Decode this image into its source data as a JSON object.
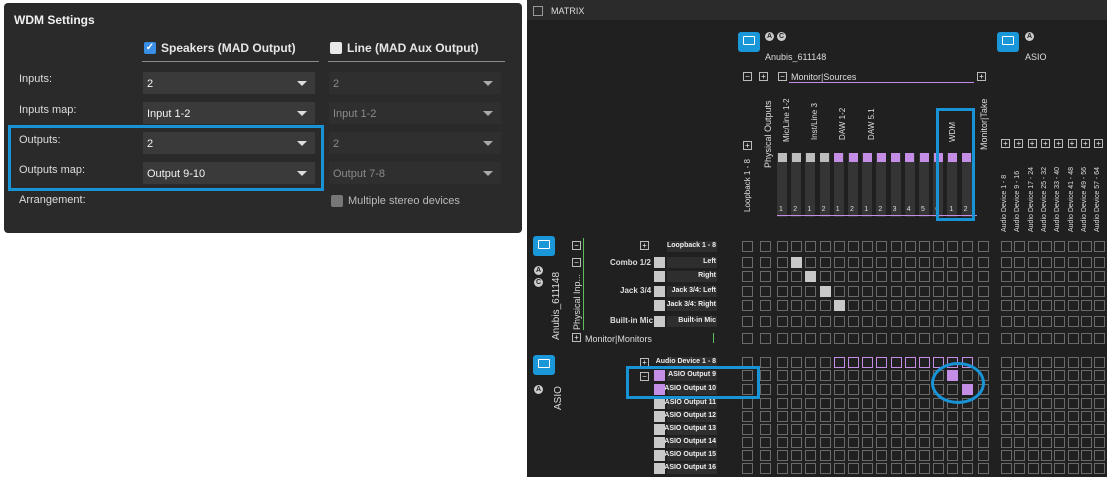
{
  "wdm": {
    "title": "WDM Settings",
    "col1": {
      "label": "Speakers (MAD Output)",
      "checked": true
    },
    "col2": {
      "label": "Line (MAD Aux Output)",
      "checked": false
    },
    "rows": [
      {
        "label": "Inputs:",
        "v1": "2",
        "v2": "2"
      },
      {
        "label": "Inputs map:",
        "v1": "Input 1-2",
        "v2": "Input 1-2"
      },
      {
        "label": "Outputs:",
        "v1": "2",
        "v2": "2"
      },
      {
        "label": "Outputs map:",
        "v1": "Output 9-10",
        "v2": "Output 7-8"
      }
    ],
    "arrangement_label": "Arrangement:",
    "multiple_stereo": "Multiple stereo devices"
  },
  "matrix": {
    "title": "MATRIX",
    "dev1": "Anubis_611148",
    "dev2": "ASIO",
    "monitor_sources": "Monitor|Sources",
    "physical_outputs": "Physical Outputs",
    "monitor_take": "Monitor|Take",
    "loopback": "Loopback 1 - 8",
    "col_groups": [
      "Mic/Line 1-2",
      "Inst/Line 3",
      "DAW 1-2",
      "DAW 5.1",
      "WDM"
    ],
    "col_nums": [
      "1",
      "2",
      "1",
      "2",
      "1",
      "2",
      "1",
      "2",
      "3",
      "4",
      "5",
      "6",
      "1",
      "2"
    ],
    "asio_cols": [
      "Audio Device 1 - 8",
      "Audio Device 9 - 16",
      "Audio Device 17 - 24",
      "Audio Device 25 - 32",
      "Audio Device 33 - 40",
      "Audio Device 41 - 48",
      "Audio Device 49 - 56",
      "Audio Device 57 - 64"
    ],
    "left_dev1": "Anubis_611148",
    "physical_inputs": "Physical Inp...",
    "left_dev2": "ASIO",
    "monitor_monitors": "Monitor|Monitors",
    "row_groups": {
      "combo": "Combo 1/2",
      "jack": "Jack 3/4",
      "builtin": "Built-in Mic"
    },
    "rows1": [
      "Loopback 1 - 8",
      "Left",
      "Right",
      "Jack 3/4: Left",
      "Jack 3/4: Right",
      "Built-in Mic"
    ],
    "rows2": [
      "Audio Device 1 - 8",
      "ASIO Output 9",
      "ASIO Output 10",
      "ASIO Output 11",
      "ASIO Output 12",
      "ASIO Output 13",
      "ASIO Output 14",
      "ASIO Output 15",
      "ASIO Output 16"
    ],
    "badge_a": "A",
    "badge_c": "C"
  },
  "colors": {
    "accent": "#1893d6",
    "purple": "#c48ee6",
    "panel": "#2a2a2a"
  }
}
